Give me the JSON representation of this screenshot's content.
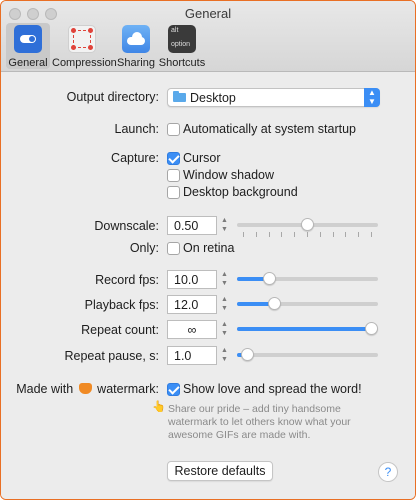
{
  "window": {
    "title": "General"
  },
  "toolbar": {
    "items": [
      {
        "label": "General",
        "icon": "toggle-icon",
        "selected": true
      },
      {
        "label": "Compression",
        "icon": "compression-icon",
        "selected": false
      },
      {
        "label": "Sharing",
        "icon": "cloud-icon",
        "selected": false
      },
      {
        "label": "Shortcuts",
        "icon": "keyboard-icon",
        "selected": false,
        "key_top": "alt",
        "key_bottom": "option"
      }
    ]
  },
  "output_directory": {
    "label": "Output directory:",
    "value": "Desktop"
  },
  "launch": {
    "label": "Launch:",
    "option": "Automatically at system startup",
    "checked": false
  },
  "capture": {
    "label": "Capture:",
    "options": [
      {
        "label": "Cursor",
        "checked": true
      },
      {
        "label": "Window shadow",
        "checked": false
      },
      {
        "label": "Desktop background",
        "checked": false
      }
    ]
  },
  "downscale": {
    "label": "Downscale:",
    "value": "0.50",
    "level": 0.5
  },
  "only": {
    "label": "Only:",
    "option": "On retina",
    "checked": false
  },
  "record_fps": {
    "label": "Record fps:",
    "value": "10.0",
    "level": 0.2
  },
  "playback_fps": {
    "label": "Playback fps:",
    "value": "12.0",
    "level": 0.24
  },
  "repeat_count": {
    "label": "Repeat count:",
    "value": "∞",
    "level": 1.0
  },
  "repeat_pause": {
    "label": "Repeat pause, s:",
    "value": "1.0",
    "level": 0.03
  },
  "watermark": {
    "label_prefix": "Made with",
    "label_suffix": "watermark:",
    "option": "Show love and spread the word!",
    "checked": true,
    "note_icon": "👆",
    "note": "Share our pride – add tiny handsome watermark to let others know what your awesome GIFs are made with."
  },
  "restore_defaults": "Restore defaults",
  "help": "?",
  "colors": {
    "accent": "#3b8ef5",
    "border": "#e96f24"
  }
}
